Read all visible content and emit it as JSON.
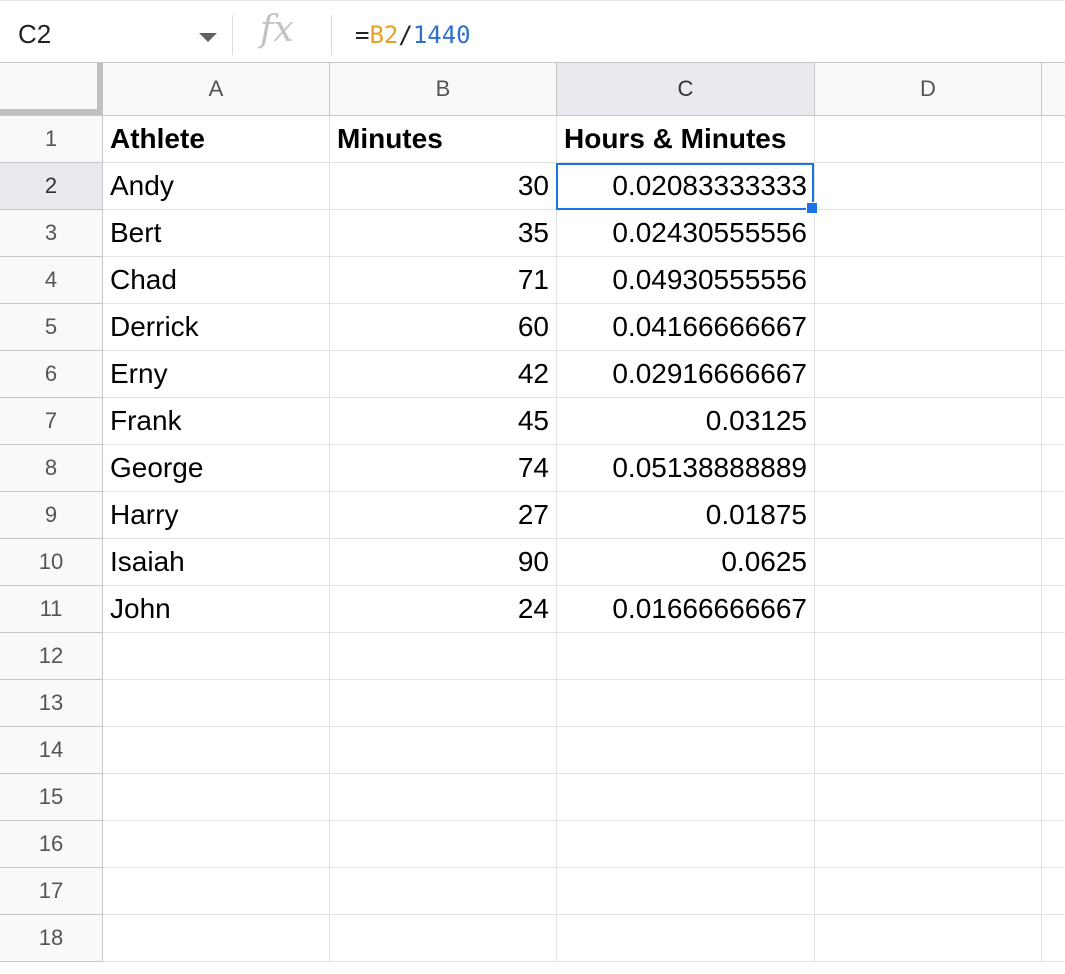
{
  "formula_bar": {
    "cell_ref": "C2",
    "fx_label": "fx",
    "formula": {
      "eq": "=",
      "ref": "B2",
      "op": "/",
      "num": "1440"
    }
  },
  "columns": [
    "A",
    "B",
    "C",
    "D"
  ],
  "rows": [
    "1",
    "2",
    "3",
    "4",
    "5",
    "6",
    "7",
    "8",
    "9",
    "10",
    "11",
    "12",
    "13",
    "14",
    "15",
    "16",
    "17",
    "18"
  ],
  "headers": {
    "A": "Athlete",
    "B": "Minutes",
    "C": "Hours & Minutes"
  },
  "data": [
    {
      "A": "Andy",
      "B": "30",
      "C": "0.02083333333"
    },
    {
      "A": "Bert",
      "B": "35",
      "C": "0.02430555556"
    },
    {
      "A": "Chad",
      "B": "71",
      "C": "0.04930555556"
    },
    {
      "A": "Derrick",
      "B": "60",
      "C": "0.04166666667"
    },
    {
      "A": "Erny",
      "B": "42",
      "C": "0.02916666667"
    },
    {
      "A": "Frank",
      "B": "45",
      "C": "0.03125"
    },
    {
      "A": "George",
      "B": "74",
      "C": "0.05138888889"
    },
    {
      "A": "Harry",
      "B": "27",
      "C": "0.01875"
    },
    {
      "A": "Isaiah",
      "B": "90",
      "C": "0.0625"
    },
    {
      "A": "John",
      "B": "24",
      "C": "0.01666666667"
    }
  ],
  "selected_cell": "C2",
  "colors": {
    "selection": "#1a73e8",
    "ref_color": "#e5a22a",
    "num_color": "#2e6fd1"
  }
}
